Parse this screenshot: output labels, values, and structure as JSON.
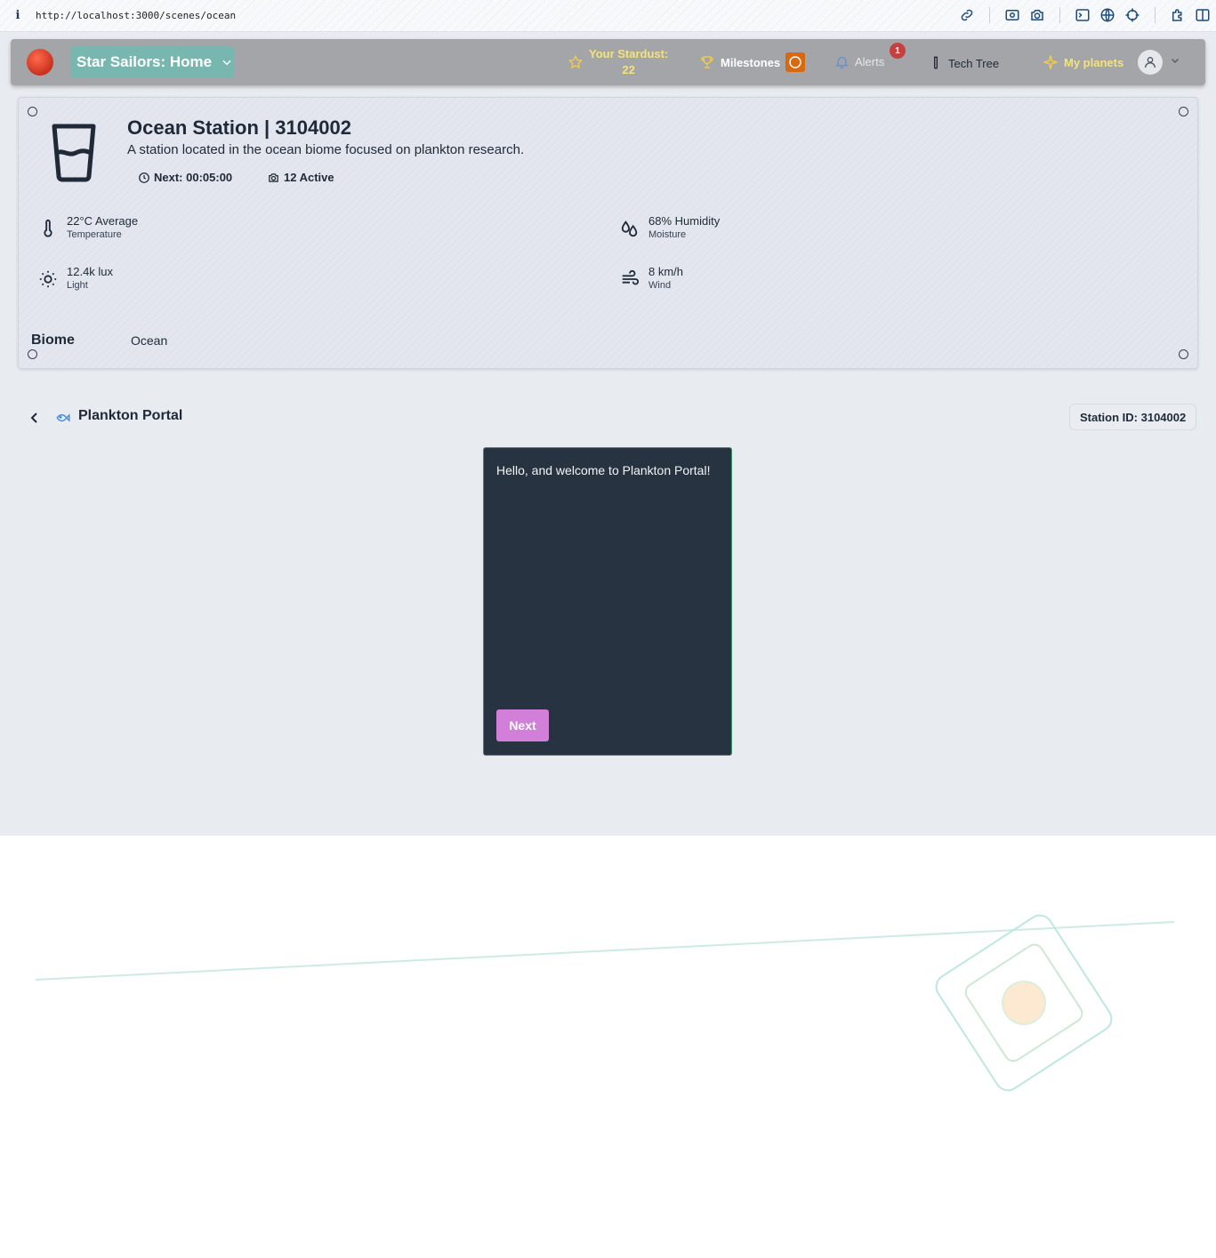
{
  "browser": {
    "url": "http://localhost:3000/scenes/ocean",
    "info_glyph": "i"
  },
  "navbar": {
    "home_label": "Star Sailors: Home",
    "stardust_label": "Your Stardust:",
    "stardust_value": "22",
    "milestones_label": "Milestones",
    "alerts_label": "Alerts",
    "alerts_count": "1",
    "techtree_label": "Tech Tree",
    "myplanets_label": "My planets"
  },
  "station": {
    "title": "Ocean Station | 3104002",
    "description": "A station located in the ocean biome focused on plankton research.",
    "next_label": "Next: 00:05:00",
    "active_label": "12 Active",
    "stats": [
      {
        "value": "22°C Average",
        "label": "Temperature",
        "icon": "thermometer-icon"
      },
      {
        "value": "68% Humidity",
        "label": "Moisture",
        "icon": "droplets-icon"
      },
      {
        "value": "12.4k lux",
        "label": "Light",
        "icon": "sun-icon"
      },
      {
        "value": "8 km/h",
        "label": "Wind",
        "icon": "wind-icon"
      }
    ],
    "biome_label": "Biome",
    "biome_value": "Ocean"
  },
  "portal": {
    "title": "Plankton Portal",
    "station_id": "Station ID: 3104002",
    "dialog_text": "Hello, and welcome to Plankton Portal!",
    "next_button": "Next"
  },
  "colors": {
    "navbar_bg": "#a3a5a8",
    "home_btn": "#78b7b0",
    "stardust": "#f6e27a",
    "milestones_badge": "#d9690e",
    "alert_badge": "#c44141",
    "dialog_bg": "#283341",
    "dialog_border": "#3c8f6e",
    "next_btn": "#d17fd8"
  }
}
